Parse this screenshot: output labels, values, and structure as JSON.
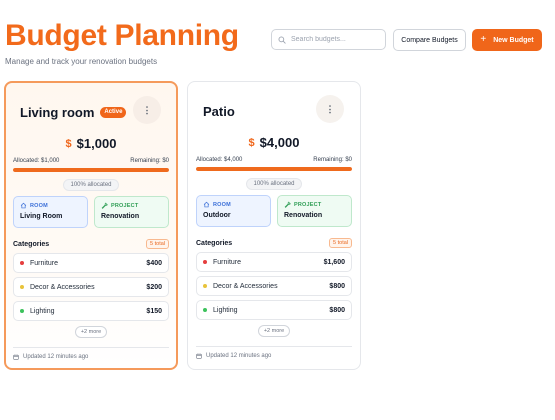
{
  "header": {
    "title": "Budget Planning",
    "subtitle": "Manage and track your renovation budgets"
  },
  "toolbar": {
    "search_placeholder": "Search budgets...",
    "compare_label": "Compare Budgets",
    "new_label": "New Budget"
  },
  "colors": {
    "accent": "#f0661a",
    "room_blue": "#3b6fd8",
    "project_green": "#2f9e55"
  },
  "cards": [
    {
      "name": "Living room",
      "badge": "Active",
      "amount": "$1,000",
      "allocated": "Allocated: $1,000",
      "remaining": "Remaining: $0",
      "progress_percent": 100,
      "allocated_percent_label": "100% allocated",
      "room_label": "ROOM",
      "room_value": "Living Room",
      "project_label": "PROJECT",
      "project_value": "Renovation",
      "categories_title": "Categories",
      "categories_total": "5 total",
      "categories": [
        {
          "name": "Furniture",
          "amount": "$400",
          "color": "#e53e3e"
        },
        {
          "name": "Decor & Accessories",
          "amount": "$200",
          "color": "#e8c33a"
        },
        {
          "name": "Lighting",
          "amount": "$150",
          "color": "#3cc25c"
        }
      ],
      "more_label": "+2 more",
      "updated": "Updated 12 minutes ago"
    },
    {
      "name": "Patio",
      "badge": "",
      "amount": "$4,000",
      "allocated": "Allocated: $4,000",
      "remaining": "Remaining: $0",
      "progress_percent": 100,
      "allocated_percent_label": "100% allocated",
      "room_label": "ROOM",
      "room_value": "Outdoor",
      "project_label": "PROJECT",
      "project_value": "Renovation",
      "categories_title": "Categories",
      "categories_total": "5 total",
      "categories": [
        {
          "name": "Furniture",
          "amount": "$1,600",
          "color": "#e53e3e"
        },
        {
          "name": "Decor & Accessories",
          "amount": "$800",
          "color": "#e8c33a"
        },
        {
          "name": "Lighting",
          "amount": "$800",
          "color": "#3cc25c"
        }
      ],
      "more_label": "+2 more",
      "updated": "Updated 12 minutes ago"
    }
  ]
}
